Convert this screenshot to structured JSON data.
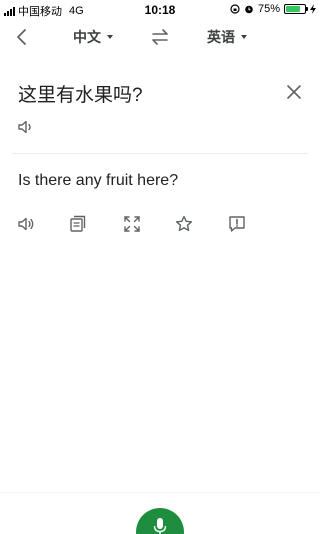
{
  "status_bar": {
    "carrier": "中国移动",
    "network": "4G",
    "time": "10:18",
    "battery_percent_label": "75%",
    "battery_level": 0.75
  },
  "toolbar": {
    "source_language": "中文",
    "target_language": "英语"
  },
  "source": {
    "text": "这里有水果吗?"
  },
  "translation": {
    "text": "Is there any fruit here?"
  },
  "colors": {
    "accent_green": "#1e8e3e",
    "icon_gray": "#5f6368",
    "battery_green": "#34c759"
  },
  "icons": {
    "back": "chevron-left-icon",
    "swap": "swap-arrows-icon",
    "clear": "close-icon",
    "speaker": "speaker-icon",
    "copy": "copy-icon",
    "fullscreen": "fullscreen-icon",
    "star": "star-icon",
    "report": "report-icon",
    "mic": "microphone-icon"
  }
}
